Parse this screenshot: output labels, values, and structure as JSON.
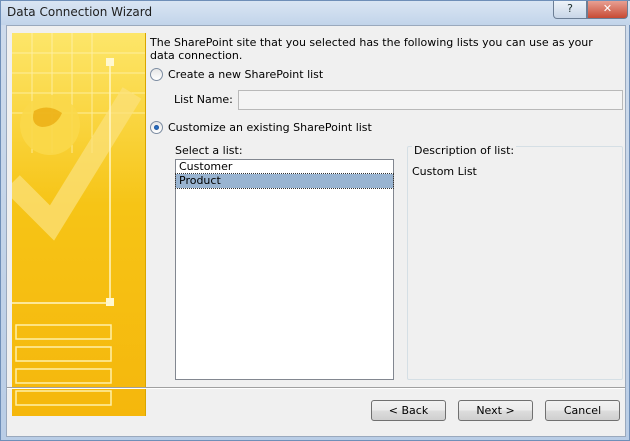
{
  "window": {
    "title": "Data Connection Wizard",
    "help_label": "?",
    "close_label": "✕"
  },
  "intro_text": "The SharePoint site that you selected has the following lists you can use as your data connection.",
  "options": {
    "create_new_label": "Create a new SharePoint list",
    "create_new_selected": false,
    "customize_existing_label": "Customize an existing SharePoint list",
    "customize_existing_selected": true
  },
  "list_name": {
    "label": "List Name:",
    "value": ""
  },
  "select_list": {
    "label": "Select a list:",
    "items": [
      "Customer",
      "Product"
    ],
    "selected": "Product"
  },
  "description": {
    "label": "Description of list:",
    "value": "Custom List"
  },
  "buttons": {
    "back": "< Back",
    "next": "Next >",
    "cancel": "Cancel"
  },
  "colors": {
    "selection": "#99b4d1",
    "art_yellow": "#f6c416"
  }
}
